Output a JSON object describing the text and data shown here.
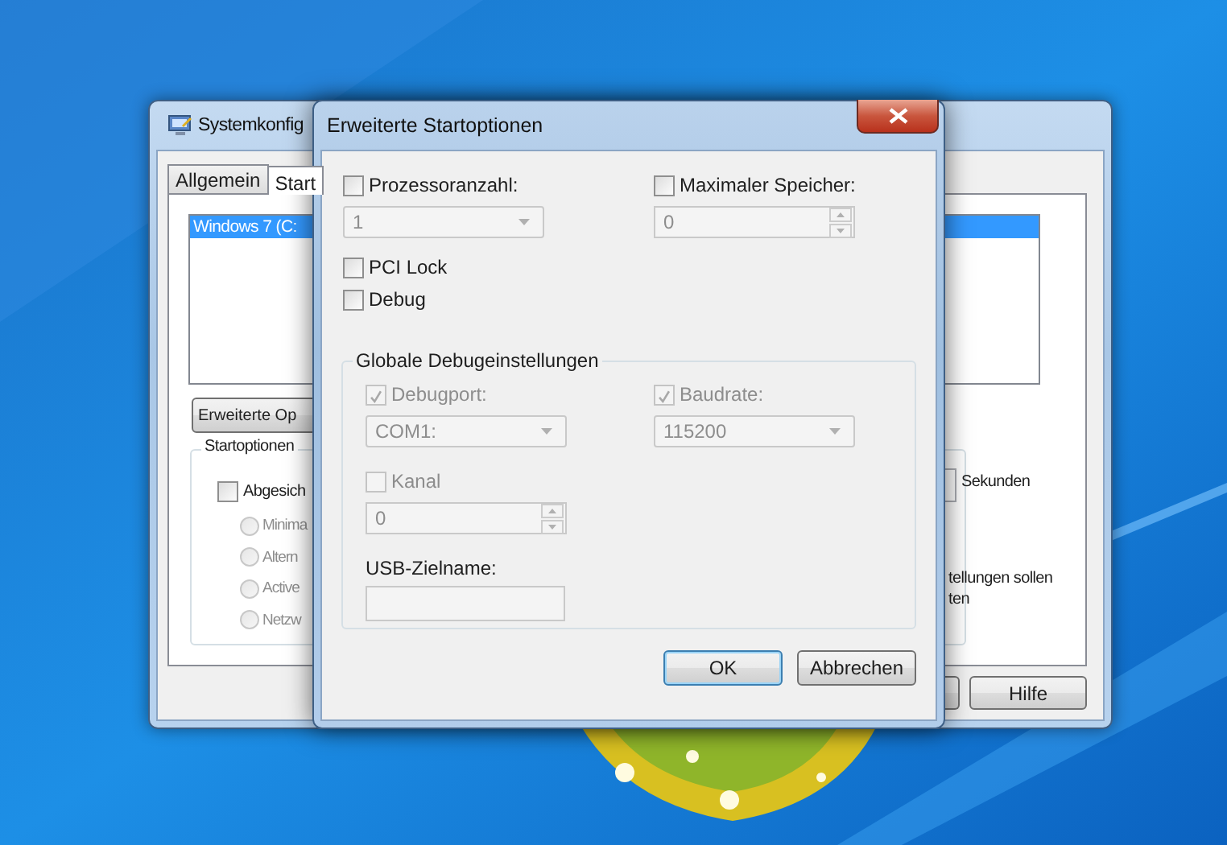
{
  "background_window": {
    "title": "Systemkonfig",
    "tabs": [
      {
        "label": "Allgemein",
        "selected": false
      },
      {
        "label": "Start",
        "selected": true
      }
    ],
    "boot_list": [
      {
        "label": "Windows 7 (C:",
        "selected": true
      }
    ],
    "advanced_button": "Erweiterte Op",
    "start_options": {
      "title": "Startoptionen",
      "safe_boot": {
        "label": "Abgesich",
        "checked": false
      },
      "radios": [
        {
          "label": "Minima",
          "selected": false,
          "disabled": true
        },
        {
          "label": "Altern",
          "selected": false,
          "disabled": true
        },
        {
          "label": "Active",
          "selected": false,
          "disabled": true
        },
        {
          "label": "Netzw",
          "selected": false,
          "disabled": true
        }
      ]
    },
    "timeout_unit": "Sekunden",
    "note_lines": [
      "tellungen sollen",
      "ten"
    ],
    "buttons": [
      "Hilfe"
    ]
  },
  "dialog": {
    "title": "Erweiterte Startoptionen",
    "processor_count": {
      "label": "Prozessoranzahl:",
      "checked": false,
      "value": "1"
    },
    "max_memory": {
      "label": "Maximaler Speicher:",
      "checked": false,
      "value": "0"
    },
    "options": [
      {
        "label": "PCI Lock",
        "checked": false
      },
      {
        "label": "Debug",
        "checked": false
      }
    ],
    "debug_group": {
      "title": "Globale Debugeinstellungen",
      "debug_port": {
        "label": "Debugport:",
        "checked": true,
        "disabled": true,
        "value": "COM1:"
      },
      "baud_rate": {
        "label": "Baudrate:",
        "checked": true,
        "disabled": true,
        "value": "115200"
      },
      "channel": {
        "label": "Kanal",
        "checked": false,
        "disabled": true,
        "value": "0"
      },
      "usb_target": {
        "label": "USB-Zielname:"
      }
    },
    "buttons": [
      {
        "label": "OK",
        "default": true
      },
      {
        "label": "Abbrechen",
        "default": false
      }
    ]
  }
}
